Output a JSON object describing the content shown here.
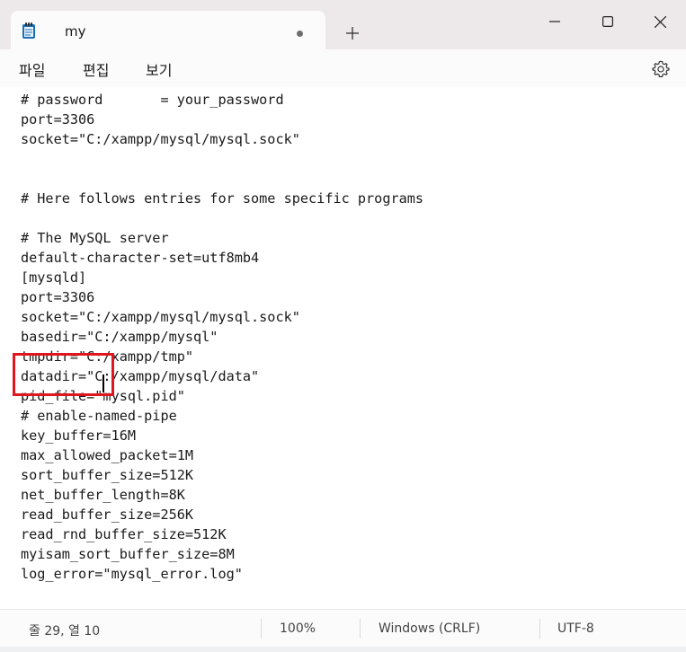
{
  "tab": {
    "title": "my",
    "icon": "notepad-icon"
  },
  "window_controls": [
    "minimize-icon",
    "maximize-icon",
    "close-icon"
  ],
  "menu": [
    {
      "label": "파일"
    },
    {
      "label": "편집"
    },
    {
      "label": "보기"
    }
  ],
  "editor": {
    "lines": [
      "# password       = your_password",
      "port=3306",
      "socket=\"C:/xampp/mysql/mysql.sock\"",
      "",
      "",
      "# Here follows entries for some specific programs",
      "",
      "# The MySQL server",
      "default-character-set=utf8mb4",
      "[mysqld]",
      "port=3306",
      "socket=\"C:/xampp/mysql/mysql.sock\"",
      "basedir=\"C:/xampp/mysql\"",
      "tmpdir=\"C:/xampp/tmp\"",
      "datadir=\"C:/xampp/mysql/data\"",
      "pid_file=\"mysql.pid\"",
      "# enable-named-pipe",
      "key_buffer=16M",
      "max_allowed_packet=1M",
      "sort_buffer_size=512K",
      "net_buffer_length=8K",
      "read_buffer_size=256K",
      "read_rnd_buffer_size=512K",
      "myisam_sort_buffer_size=8M",
      "log_error=\"mysql_error.log\""
    ]
  },
  "status": {
    "position": "줄 29, 열 10",
    "zoom": "100%",
    "line_ending": "Windows (CRLF)",
    "encoding": "UTF-8"
  },
  "colors": {
    "highlight_box": "#e0161f",
    "titlebar": "#ede8ea"
  }
}
